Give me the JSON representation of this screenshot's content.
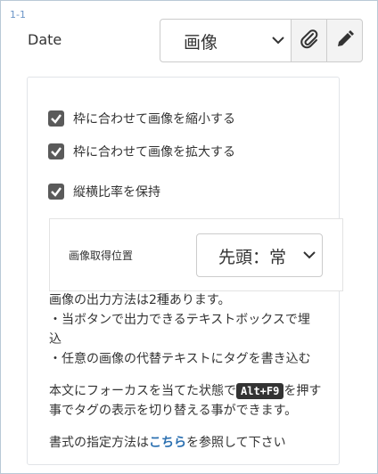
{
  "row_number": "1-1",
  "field": {
    "label": "Date",
    "type_select_value": "画像",
    "attach_icon": "paperclip-icon",
    "edit_icon": "pencil-icon"
  },
  "options": {
    "checkboxes": [
      {
        "label": "枠に合わせて画像を縮小する",
        "checked": true
      },
      {
        "label": "枠に合わせて画像を拡大する",
        "checked": true
      },
      {
        "label": "縦横比率を保持",
        "checked": true
      }
    ],
    "position_label": "画像取得位置",
    "position_value": "先頭：常"
  },
  "help": {
    "line1": "画像の出力方法は2種あります。",
    "line2a": "・当ボタンで出力できるテキストボックスで埋",
    "line2b": "込",
    "line3": "・任意の画像の代替テキストにタグを書き込む",
    "shortcut_pre": "本文にフォーカスを当てた状態で",
    "shortcut_key": "Alt+F9",
    "shortcut_post": "を押す",
    "shortcut_line2": "事でタグの表示を切り替える事ができます。",
    "format_pre": "書式の指定方法は",
    "format_link": "こちら",
    "format_post": "を参照して下さい"
  }
}
